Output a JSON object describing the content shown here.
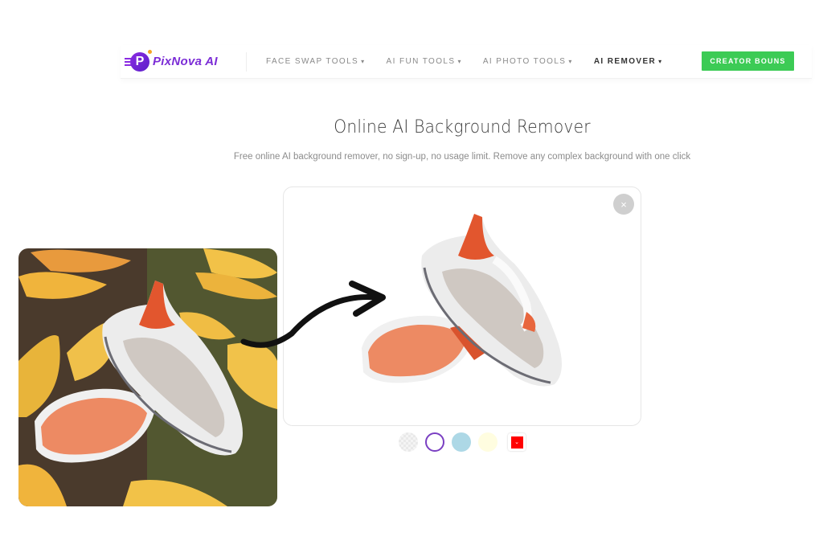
{
  "brand": {
    "logo_letter": "P",
    "name": "PixNova AI"
  },
  "nav": {
    "items": [
      {
        "label": "FACE SWAP TOOLS",
        "active": false
      },
      {
        "label": "AI FUN TOOLS",
        "active": false
      },
      {
        "label": "AI PHOTO TOOLS",
        "active": false
      },
      {
        "label": "AI REMOVER",
        "active": true
      }
    ],
    "caret": "▾",
    "cta_label": "CREATOR BOUNS"
  },
  "page": {
    "title": "Online AI Background Remover",
    "subtitle": "Free online AI background remover, no sign-up, no usage limit. Remove any complex background with one click"
  },
  "result": {
    "close_icon": "×",
    "background_options": [
      {
        "name": "transparent",
        "color": "transparent",
        "selected": false
      },
      {
        "name": "white",
        "color": "#ffffff",
        "selected": true
      },
      {
        "name": "light-blue",
        "color": "#add8e6",
        "selected": false
      },
      {
        "name": "light-yellow",
        "color": "#fffde0",
        "selected": false
      },
      {
        "name": "custom-color",
        "color": "#ff0000",
        "selected": false
      }
    ],
    "picker_caret": "⌄"
  },
  "colors": {
    "brand": "#7b2cd6",
    "cta": "#3ccb55",
    "shoe_accent": "#e8663d"
  }
}
